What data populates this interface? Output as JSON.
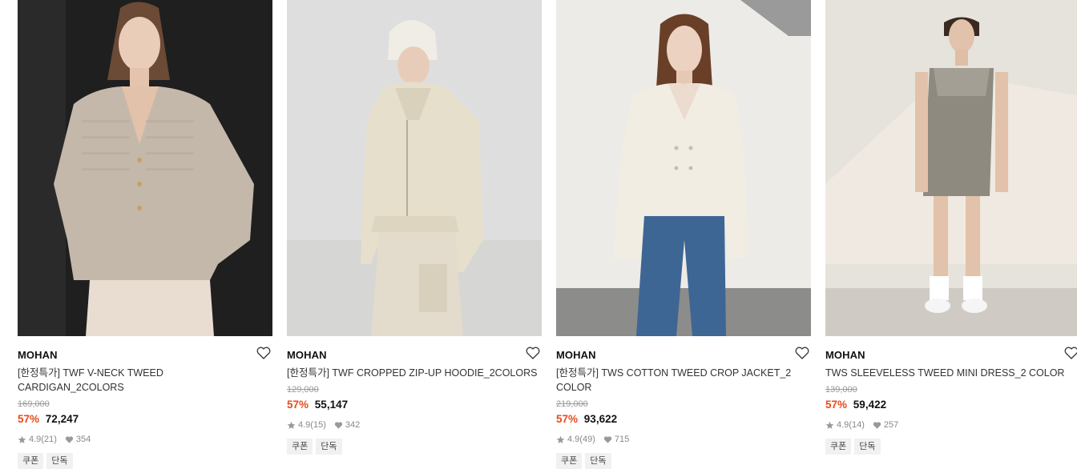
{
  "products": [
    {
      "brand": "MOHAN",
      "name": "[한정특가] TWF V-NECK TWEED CARDIGAN_2COLORS",
      "original_price": "169,000",
      "discount": "57%",
      "price": "72,247",
      "rating": "4.9",
      "reviews": "(21)",
      "likes": "354",
      "tags": [
        "쿠폰",
        "단독"
      ]
    },
    {
      "brand": "MOHAN",
      "name": "[한정특가] TWF CROPPED ZIP-UP HOODIE_2COLORS",
      "original_price": "129,000",
      "discount": "57%",
      "price": "55,147",
      "rating": "4.9",
      "reviews": "(15)",
      "likes": "342",
      "tags": [
        "쿠폰",
        "단독"
      ]
    },
    {
      "brand": "MOHAN",
      "name": "[한정특가] TWS COTTON TWEED CROP JACKET_2 COLOR",
      "original_price": "219,000",
      "discount": "57%",
      "price": "93,622",
      "rating": "4.9",
      "reviews": "(49)",
      "likes": "715",
      "tags": [
        "쿠폰",
        "단독"
      ]
    },
    {
      "brand": "MOHAN",
      "name": "TWS SLEEVELESS TWEED MINI DRESS_2 COLOR",
      "original_price": "139,000",
      "discount": "57%",
      "price": "59,422",
      "rating": "4.9",
      "reviews": "(14)",
      "likes": "257",
      "tags": [
        "쿠폰",
        "단독"
      ]
    }
  ],
  "colors": {
    "discount": "#e84a1c",
    "muted": "#999999"
  },
  "icons": {
    "wishlist": "heart-outline-icon",
    "rating": "star-icon",
    "likes": "heart-filled-icon"
  }
}
